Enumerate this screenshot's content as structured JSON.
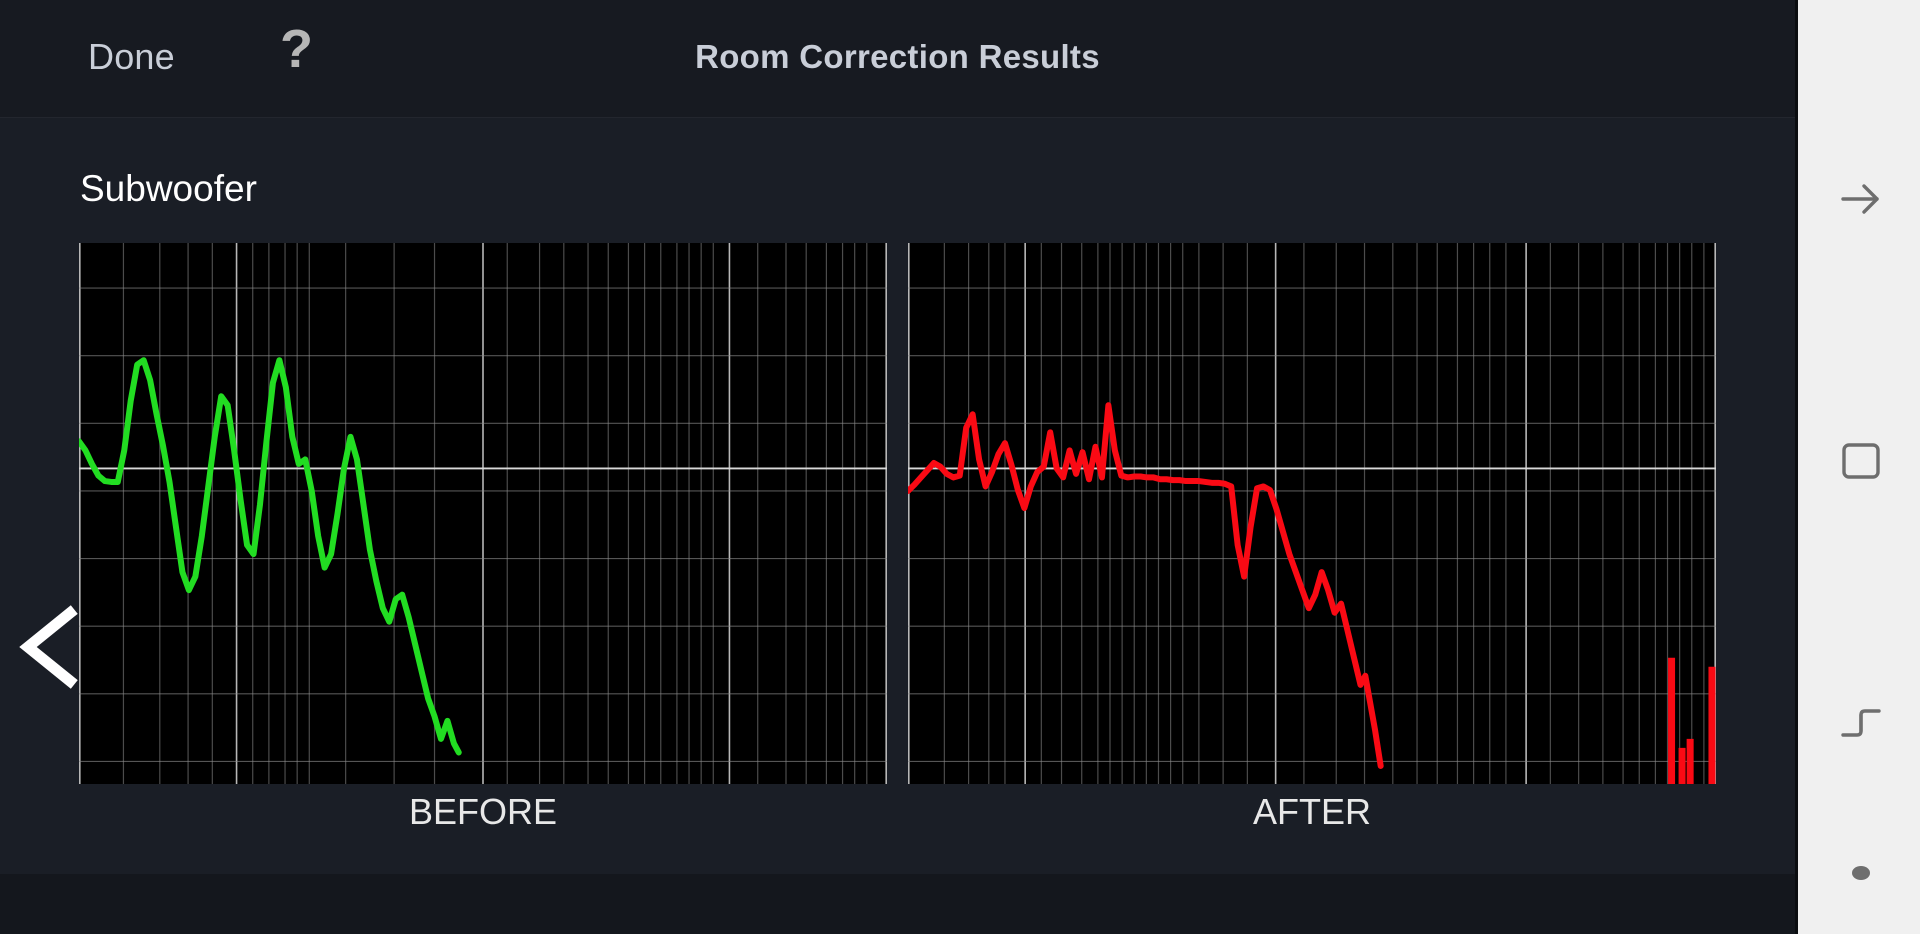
{
  "header": {
    "done_label": "Done",
    "help_icon": "question-mark-icon",
    "title": "Room Correction Results"
  },
  "main": {
    "section_title": "Subwoofer",
    "prev_chevron_icon": "chevron-left-icon"
  },
  "navbar": {
    "items": [
      {
        "name": "back",
        "icon": "arrow-left-icon"
      },
      {
        "name": "recents",
        "icon": "square-outline-icon"
      },
      {
        "name": "split-screen",
        "icon": "split-screen-icon"
      },
      {
        "name": "home",
        "icon": "dot-icon"
      }
    ]
  },
  "colors": {
    "background": "#14171d",
    "header_bg": "#171a21",
    "panel_bg": "#1a1e26",
    "plot_bg": "#000000",
    "grid": "#8a8a8a",
    "grid_major": "#d8d8d8",
    "before_trace": "#22dd22",
    "after_trace": "#fa0a14",
    "text_primary": "#ffffff",
    "text_secondary": "#c9ced8",
    "navbar_bg": "#f0f0f0",
    "navbar_icon": "#6e6e6e"
  },
  "chart_data": [
    {
      "type": "line",
      "title": "BEFORE",
      "label": "BEFORE",
      "series_color": "#22dd22",
      "xlabel": "",
      "ylabel": "",
      "xscale": "log",
      "grid": true,
      "legend": "none",
      "ylim": [
        -35,
        25
      ],
      "y_gridlines": [
        20,
        12.5,
        5,
        0,
        -2.5,
        -10,
        -17.5,
        -25,
        -32.5
      ],
      "y_reference_line": 0,
      "x_major_gridlines_norm": [
        0.0,
        0.195,
        0.5,
        0.805,
        1.0
      ],
      "x_minor_gridlines_norm": [
        0.055,
        0.1,
        0.135,
        0.165,
        0.215,
        0.235,
        0.255,
        0.27,
        0.285,
        0.33,
        0.39,
        0.44,
        0.53,
        0.57,
        0.6,
        0.63,
        0.655,
        0.68,
        0.7,
        0.72,
        0.74,
        0.755,
        0.77,
        0.785,
        0.84,
        0.875,
        0.9,
        0.925,
        0.945,
        0.96,
        0.975
      ],
      "x_norm": [
        0.0,
        0.008,
        0.016,
        0.024,
        0.032,
        0.04,
        0.048,
        0.056,
        0.064,
        0.072,
        0.08,
        0.088,
        0.096,
        0.104,
        0.112,
        0.12,
        0.128,
        0.136,
        0.144,
        0.152,
        0.16,
        0.168,
        0.176,
        0.184,
        0.192,
        0.2,
        0.208,
        0.216,
        0.224,
        0.232,
        0.24,
        0.248,
        0.256,
        0.264,
        0.272,
        0.28,
        0.288,
        0.296,
        0.304,
        0.312,
        0.32,
        0.328,
        0.336,
        0.344,
        0.352,
        0.36,
        0.368,
        0.376,
        0.384
      ],
      "y_db": [
        3.0,
        2.0,
        0.5,
        -0.8,
        -1.4,
        -1.5,
        -1.5,
        2.0,
        7.5,
        11.5,
        12.0,
        9.8,
        6.0,
        2.5,
        -1.5,
        -6.5,
        -11.5,
        -13.5,
        -12.0,
        -7.5,
        -2.0,
        3.5,
        8.0,
        7.0,
        2.0,
        -3.5,
        -8.5,
        -9.5,
        -4.0,
        3.0,
        9.5,
        12.0,
        9.0,
        3.5,
        0.5,
        1.0,
        -2.5,
        -7.5,
        -11.0,
        -9.5,
        -5.0,
        0.0,
        3.5,
        1.0,
        -4.0,
        -9.0,
        -12.5,
        -15.5,
        -17.0
      ],
      "y_db_tail": [
        -14.5,
        -14.0,
        -16.5,
        -19.5,
        -22.5,
        -25.5,
        -27.5,
        -30.0,
        -28.0,
        -30.5,
        -31.5
      ],
      "x_norm_tail": [
        0.392,
        0.4,
        0.408,
        0.416,
        0.424,
        0.432,
        0.44,
        0.448,
        0.456,
        0.464,
        0.47
      ],
      "trace_end_norm": 0.47,
      "notes": "Uncorrected subwoofer response: large peaks and dips of +/-12 dB, rolling off steeply above ~45% of the log frequency axis."
    },
    {
      "type": "line",
      "title": "AFTER",
      "label": "AFTER",
      "series_color": "#fa0a14",
      "xlabel": "",
      "ylabel": "",
      "xscale": "log",
      "grid": true,
      "legend": "none",
      "ylim": [
        -35,
        25
      ],
      "y_gridlines": [
        20,
        12.5,
        5,
        0,
        -2.5,
        -10,
        -17.5,
        -25,
        -32.5
      ],
      "y_reference_line": 0,
      "x_major_gridlines_norm": [
        0.0,
        0.145,
        0.455,
        0.765,
        1.0
      ],
      "x_minor_gridlines_norm": [
        0.045,
        0.075,
        0.1,
        0.12,
        0.165,
        0.19,
        0.215,
        0.235,
        0.25,
        0.265,
        0.28,
        0.295,
        0.31,
        0.325,
        0.34,
        0.36,
        0.39,
        0.42,
        0.49,
        0.53,
        0.565,
        0.6,
        0.63,
        0.655,
        0.68,
        0.7,
        0.72,
        0.74,
        0.795,
        0.83,
        0.86,
        0.885,
        0.905,
        0.925,
        0.94,
        0.955,
        0.97,
        0.985
      ],
      "x_norm": [
        0.0,
        0.008,
        0.016,
        0.024,
        0.032,
        0.04,
        0.048,
        0.056,
        0.064,
        0.072,
        0.08,
        0.088,
        0.096,
        0.104,
        0.112,
        0.12,
        0.128,
        0.136,
        0.144,
        0.152,
        0.16,
        0.168,
        0.176,
        0.184,
        0.192,
        0.2,
        0.208,
        0.216,
        0.224,
        0.232,
        0.24,
        0.248,
        0.256,
        0.264,
        0.272,
        0.28,
        0.288,
        0.296,
        0.304,
        0.312,
        0.32,
        0.328,
        0.336,
        0.344,
        0.352,
        0.36,
        0.368,
        0.376,
        0.384,
        0.392,
        0.4,
        0.408,
        0.416,
        0.424,
        0.432,
        0.44,
        0.448,
        0.456,
        0.464,
        0.472
      ],
      "y_db": [
        -2.5,
        -1.8,
        -1.0,
        -0.2,
        0.6,
        0.2,
        -0.6,
        -1.0,
        -0.8,
        4.5,
        6.0,
        1.0,
        -2.0,
        -0.4,
        1.6,
        2.8,
        0.4,
        -2.4,
        -4.4,
        -2.0,
        -0.4,
        0.2,
        4.0,
        0.0,
        -1.0,
        2.0,
        -0.6,
        1.8,
        -1.2,
        2.4,
        -1.0,
        7.0,
        2.0,
        -0.8,
        -1.0,
        -0.9,
        -0.9,
        -1.0,
        -1.0,
        -1.2,
        -1.2,
        -1.3,
        -1.3,
        -1.4,
        -1.4,
        -1.4,
        -1.5,
        -1.6,
        -1.6,
        -1.7,
        -2.0,
        -8.5,
        -12.0,
        -6.5,
        -2.2,
        -2.0,
        -2.4,
        -4.5,
        -7.0,
        -9.5
      ],
      "y_db_tail": [
        -11.5,
        -13.5,
        -15.5,
        -14.0,
        -11.5,
        -13.5,
        -16.0,
        -15.0,
        -18.0,
        -21.0,
        -24.0,
        -23.0,
        -26.0,
        -29.0,
        -33.0
      ],
      "x_norm_tail": [
        0.48,
        0.488,
        0.496,
        0.504,
        0.512,
        0.52,
        0.528,
        0.536,
        0.544,
        0.552,
        0.56,
        0.566,
        0.572,
        0.578,
        0.585
      ],
      "trace_end_norm": 0.585,
      "artifact_bars_norm": [
        {
          "x": 0.945,
          "y_top_db": -21.0,
          "y_bottom_db": -35.0
        },
        {
          "x": 0.958,
          "y_top_db": -31.0,
          "y_bottom_db": -35.0
        },
        {
          "x": 0.968,
          "y_top_db": -30.0,
          "y_bottom_db": -35.0
        },
        {
          "x": 0.995,
          "y_top_db": -22.0,
          "y_bottom_db": -35.0
        }
      ],
      "notes": "Corrected subwoofer response: flattened to approximately 0 dB with small ripples, then a steep low-pass roll-off; small red artifacts appear at the far right edge."
    }
  ]
}
